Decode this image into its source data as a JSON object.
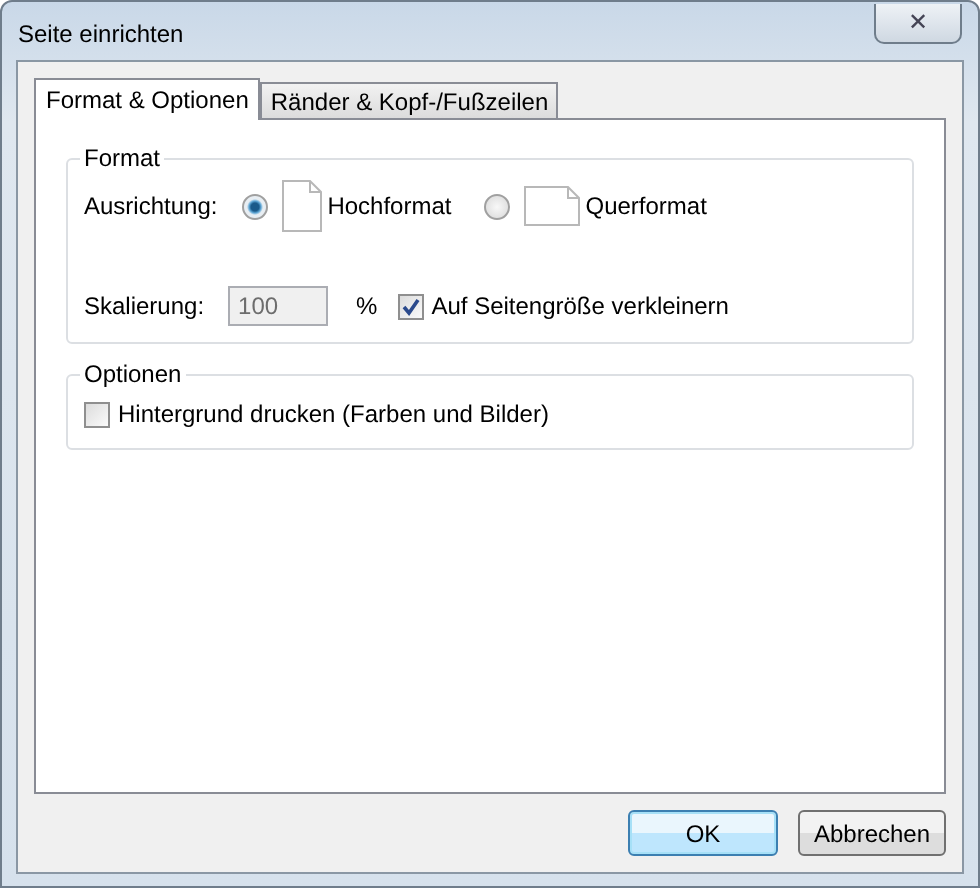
{
  "window": {
    "title": "Seite einrichten",
    "close": "✕"
  },
  "tabs": [
    {
      "label": "Format & Optionen",
      "selected": true
    },
    {
      "label": "Ränder & Kopf-/Fußzeilen",
      "selected": false
    }
  ],
  "format": {
    "legend": "Format",
    "orientation_label": "Ausrichtung:",
    "orientations": [
      {
        "label": "Hochformat",
        "kind": "portrait",
        "selected": true
      },
      {
        "label": "Querformat",
        "kind": "landscape",
        "selected": false
      }
    ],
    "scale_label": "Skalierung:",
    "scale_value": "100",
    "scale_disabled": true,
    "percent": "%",
    "shrink": {
      "label": "Auf Seitengröße verkleinern",
      "checked": true
    }
  },
  "options": {
    "legend": "Optionen",
    "items": [
      {
        "label": "Hintergrund drucken (Farben und Bilder)",
        "checked": false
      }
    ]
  },
  "buttons": [
    {
      "label": "OK",
      "default": true
    },
    {
      "label": "Abbrechen",
      "default": false
    }
  ]
}
